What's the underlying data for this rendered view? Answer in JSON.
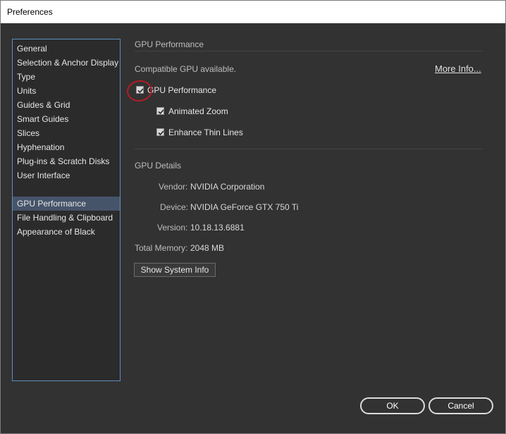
{
  "window": {
    "title": "Preferences"
  },
  "sidebar": {
    "items": [
      {
        "label": "General"
      },
      {
        "label": "Selection & Anchor Display"
      },
      {
        "label": "Type"
      },
      {
        "label": "Units"
      },
      {
        "label": "Guides & Grid"
      },
      {
        "label": "Smart Guides"
      },
      {
        "label": "Slices"
      },
      {
        "label": "Hyphenation"
      },
      {
        "label": "Plug-ins & Scratch Disks"
      },
      {
        "label": "User Interface"
      },
      {
        "label": "GPU Performance"
      },
      {
        "label": "File Handling & Clipboard"
      },
      {
        "label": "Appearance of Black"
      }
    ],
    "selected": "GPU Performance"
  },
  "gpu_performance": {
    "section_title": "GPU Performance",
    "compatible_text": "Compatible GPU available.",
    "more_info": "More Info...",
    "checkbox_gpu": {
      "label": "GPU Performance",
      "checked": true
    },
    "checkbox_zoom": {
      "label": "Animated Zoom",
      "checked": true
    },
    "checkbox_thin": {
      "label": "Enhance Thin Lines",
      "checked": true
    }
  },
  "gpu_details": {
    "section_title": "GPU Details",
    "vendor_label": "Vendor:",
    "vendor_value": "NVIDIA Corporation",
    "device_label": "Device:",
    "device_value": "NVIDIA GeForce GTX 750 Ti",
    "version_label": "Version:",
    "version_value": "10.18.13.6881",
    "memory_label": "Total Memory:",
    "memory_value": "2048 MB",
    "show_system_info": "Show System Info"
  },
  "footer": {
    "ok": "OK",
    "cancel": "Cancel"
  },
  "colors": {
    "panel_bg": "#323232",
    "selected_item": "#46546a",
    "sidebar_border": "#5c8fbf",
    "annotation_red": "#b21d24"
  }
}
